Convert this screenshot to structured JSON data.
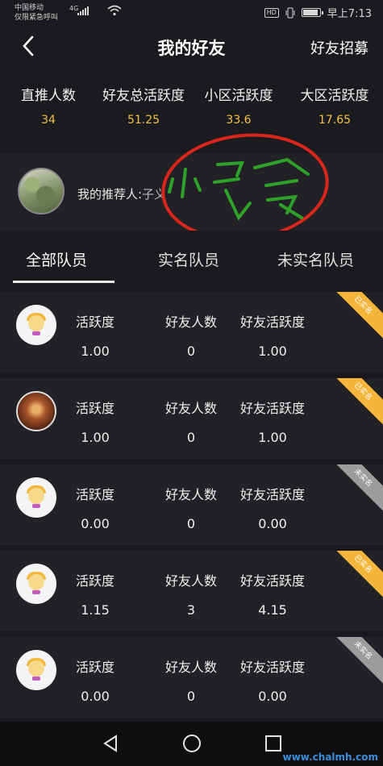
{
  "status_bar": {
    "carrier_line1": "中国移动",
    "carrier_line2": "仅限紧急呼叫",
    "network": "4G",
    "time": "早上7:13",
    "hd": "HD"
  },
  "header": {
    "title": "我的好友",
    "recruit_label": "好友招募"
  },
  "stats": [
    {
      "label": "直推人数",
      "value": "34"
    },
    {
      "label": "好友总活跃度",
      "value": "51.25"
    },
    {
      "label": "小区活跃度",
      "value": "33.6"
    },
    {
      "label": "大区活跃度",
      "value": "17.65"
    }
  ],
  "referrer": {
    "label": "我的推荐人:",
    "name": "子义"
  },
  "tabs": [
    {
      "label": "全部队员",
      "active": true
    },
    {
      "label": "实名队员",
      "active": false
    },
    {
      "label": "未实名队员",
      "active": false
    }
  ],
  "columns": {
    "activity": "活跃度",
    "friend_count": "好友人数",
    "friend_activity": "好友活跃度"
  },
  "members": [
    {
      "activity": "1.00",
      "friend_count": "0",
      "friend_activity": "1.00",
      "badge": "已实名",
      "verified": true
    },
    {
      "activity": "1.00",
      "friend_count": "0",
      "friend_activity": "1.00",
      "badge": "已实名",
      "verified": true
    },
    {
      "activity": "0.00",
      "friend_count": "0",
      "friend_activity": "0.00",
      "badge": "未实名",
      "verified": false
    },
    {
      "activity": "1.15",
      "friend_count": "3",
      "friend_activity": "4.15",
      "badge": "已实名",
      "verified": true
    },
    {
      "activity": "0.00",
      "friend_count": "0",
      "friend_activity": "0.00",
      "badge": "未实名",
      "verified": false
    }
  ],
  "watermark": "www.chalmh.com",
  "colors": {
    "background": "#1a1a1e",
    "card": "#222226",
    "stat_value": "#f2c04a",
    "verified_badge": "#f3b63a",
    "unverified_badge": "#9c9c9c",
    "scribble_red": "#d8261c",
    "scribble_green": "#2fa12a"
  }
}
